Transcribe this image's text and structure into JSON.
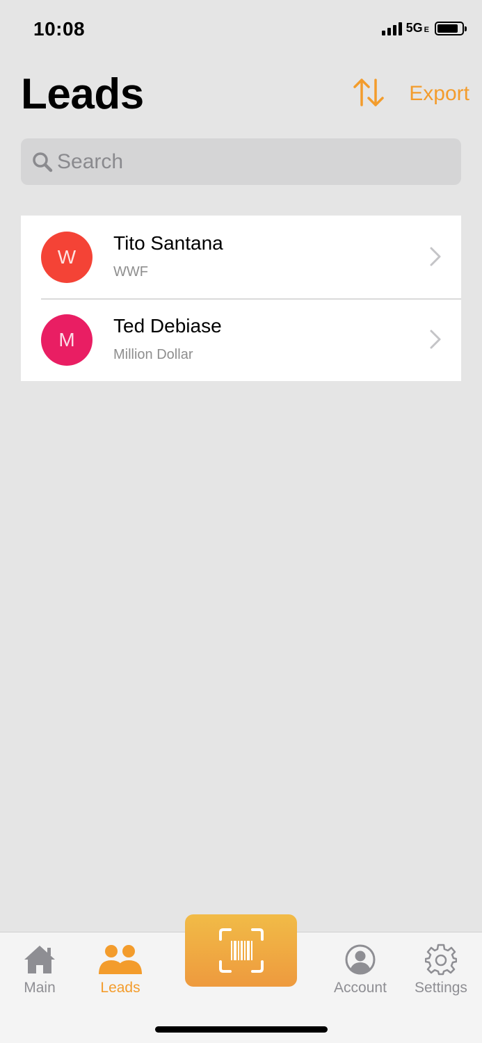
{
  "status": {
    "time": "10:08",
    "network": "5G",
    "network_suffix": "E"
  },
  "header": {
    "title": "Leads",
    "export_label": "Export",
    "sort_icon": "sort-arrows-icon"
  },
  "search": {
    "placeholder": "Search"
  },
  "leads": [
    {
      "initial": "W",
      "name": "Tito Santana",
      "company": "WWF",
      "color": "#f44336"
    },
    {
      "initial": "M",
      "name": "Ted Debiase",
      "company": "Million Dollar",
      "color": "#e91e63"
    }
  ],
  "tabs": [
    {
      "label": "Main",
      "icon": "home-icon"
    },
    {
      "label": "Leads",
      "icon": "people-icon",
      "active": true
    },
    {
      "label": "",
      "icon": "barcode-scan-icon"
    },
    {
      "label": "Account",
      "icon": "account-icon"
    },
    {
      "label": "Settings",
      "icon": "gear-icon"
    }
  ],
  "colors": {
    "accent": "#f39c2c",
    "background": "#e5e5e5",
    "scan_gradient_top": "#f1bb47",
    "scan_gradient_bottom": "#ee9a3e"
  }
}
